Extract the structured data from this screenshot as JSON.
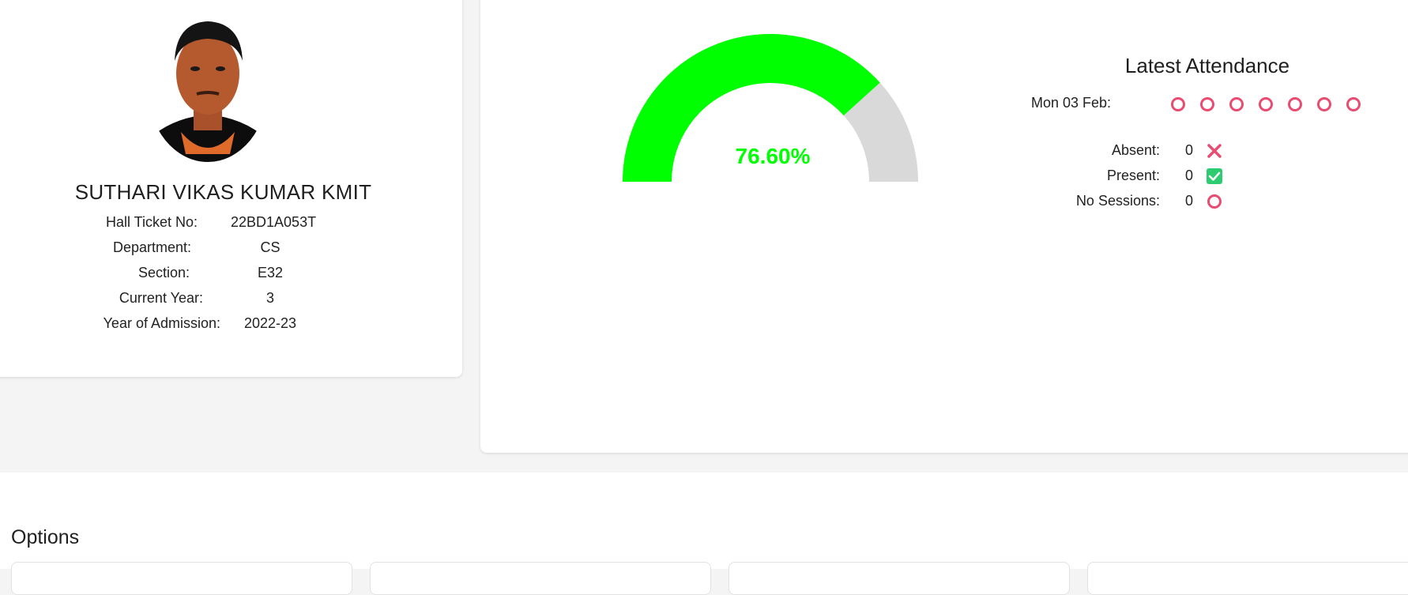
{
  "student": {
    "name": "SUTHARI VIKAS KUMAR KMIT",
    "details": [
      {
        "label": "Hall Ticket No:",
        "value": "22BD1A053T"
      },
      {
        "label": "Department:",
        "value": "CS"
      },
      {
        "label": "Section:",
        "value": "E32"
      },
      {
        "label": "Current Year:",
        "value": "3"
      },
      {
        "label": "Year of Admission:",
        "value": "2022-23"
      }
    ]
  },
  "attendance": {
    "percentage_text": "76.60%",
    "percentage_value": 76.6,
    "gauge_fill_color": "#00ff00",
    "gauge_track_color": "#d9d9d9",
    "latest_title": "Latest Attendance",
    "latest_date": "Mon 03 Feb:",
    "session_states": [
      "no-session",
      "no-session",
      "no-session",
      "no-session",
      "no-session",
      "no-session",
      "no-session"
    ],
    "legend": [
      {
        "label": "Absent:",
        "count": "0",
        "icon": "cross-icon",
        "color": "#e84c71"
      },
      {
        "label": "Present:",
        "count": "0",
        "icon": "check-icon",
        "color": "#2ecc71"
      },
      {
        "label": "No Sessions:",
        "count": "0",
        "icon": "circle-icon",
        "color": "#e84c71"
      }
    ]
  },
  "options": {
    "title": "Options"
  }
}
